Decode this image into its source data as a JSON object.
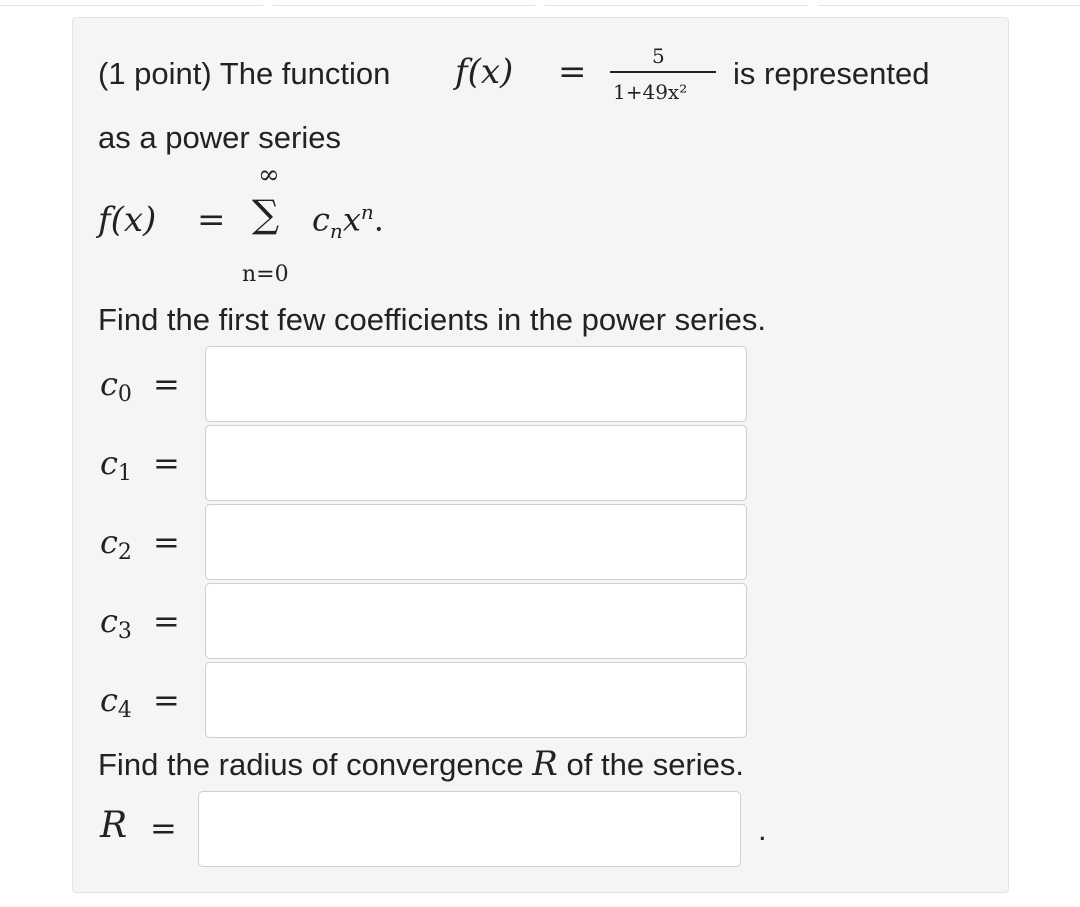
{
  "question": {
    "intro_prefix": "(1 point) The function",
    "function_lhs": "f(x)",
    "equals": "=",
    "numerator": "5",
    "denominator": "1+49x²",
    "intro_suffix": "is represented",
    "line2": "as a power series",
    "series_lhs": "f(x)",
    "series_upper": "∞",
    "series_sigma": "∑",
    "series_lower": "n=0",
    "series_term_c": "c",
    "series_term_sub": "n",
    "series_term_x": "x",
    "series_term_exp": "n",
    "series_period": ".",
    "instruction_coefficients": "Find the first few coefficients in the power series.",
    "instruction_radius_prefix": "Find the radius of convergence",
    "radius_symbol": "R",
    "instruction_radius_suffix": "of the series.",
    "trailing_period": "."
  },
  "coefficients": [
    {
      "symbol": "c",
      "index": "0",
      "value": ""
    },
    {
      "symbol": "c",
      "index": "1",
      "value": ""
    },
    {
      "symbol": "c",
      "index": "2",
      "value": ""
    },
    {
      "symbol": "c",
      "index": "3",
      "value": ""
    },
    {
      "symbol": "c",
      "index": "4",
      "value": ""
    }
  ],
  "radius": {
    "symbol": "R",
    "value": ""
  }
}
